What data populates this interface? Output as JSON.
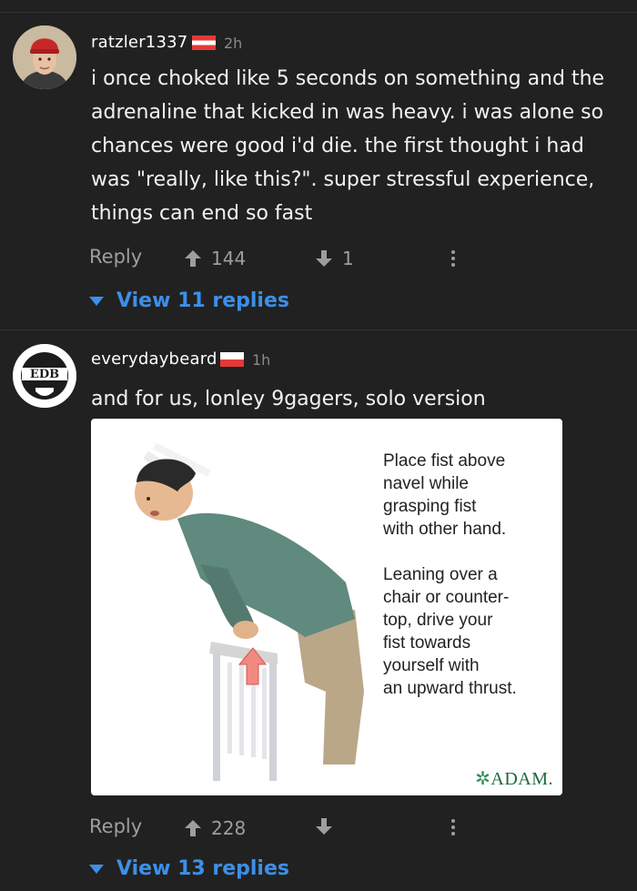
{
  "comments": [
    {
      "username": "ratzler1337",
      "time": "2h",
      "text": "i once choked like 5 seconds on something and the adrenaline that kicked in was heavy. i was alone so chances were good i'd die. the first thought i had was \"really, like this?\". super stressful experience, things can end so fast",
      "reply_label": "Reply",
      "upvotes": "144",
      "downvotes": "1",
      "view_replies": "View 11 replies"
    },
    {
      "username": "everydaybeard",
      "avatar_text": "EDB",
      "time": "1h",
      "text": "and for us, lonley 9gagers, solo version",
      "reply_label": "Reply",
      "upvotes": "228",
      "view_replies": "View 13 replies",
      "image": {
        "caption_1": [
          "Place fist above",
          "navel while",
          "grasping fist",
          "with other hand."
        ],
        "caption_2": [
          "Leaning over a",
          "chair or counter-",
          "top, drive your",
          "fist towards",
          "yourself with",
          "an upward thrust."
        ],
        "brand": "ADAM."
      }
    }
  ],
  "colors": {
    "background": "#212121",
    "link": "#3d8fe8",
    "muted": "#9e9e9e"
  }
}
